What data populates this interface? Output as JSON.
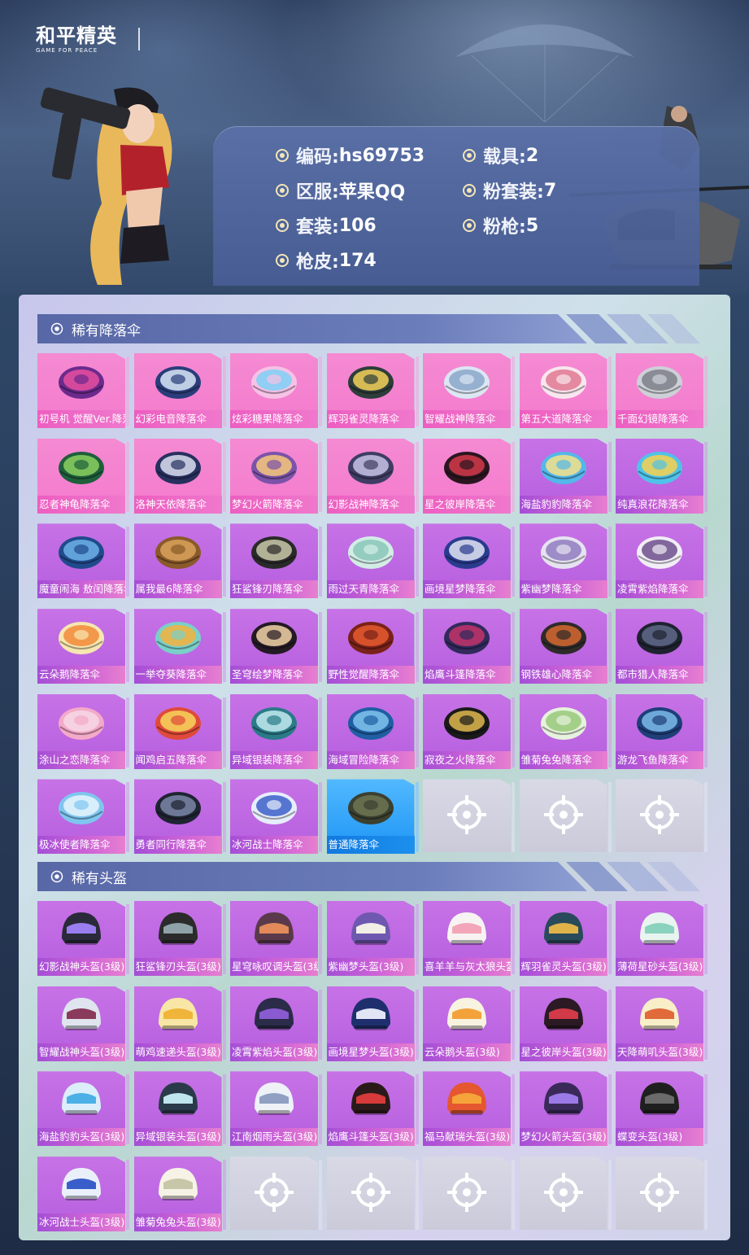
{
  "header": {
    "logo_cn": "和平精英",
    "logo_en": "GAME FOR PEACE",
    "info": [
      {
        "label": "编码: ",
        "value": "hs69753"
      },
      {
        "label": "区服: ",
        "value": "苹果QQ"
      },
      {
        "label": "套装: ",
        "value": "106"
      },
      {
        "label": "枪皮: ",
        "value": "174"
      },
      {
        "label": "载具: ",
        "value": "2"
      },
      {
        "label": "粉套装: ",
        "value": "7"
      },
      {
        "label": "粉枪: ",
        "value": "5"
      }
    ]
  },
  "sections": [
    {
      "title": "稀有降落伞",
      "items": [
        {
          "name": "初号机 觉醒Ver.降落伞",
          "tier": "pink",
          "colors": [
            "#6b2a8c",
            "#e84fa0"
          ]
        },
        {
          "name": "幻彩电音降落伞",
          "tier": "pink",
          "colors": [
            "#2a3d7a",
            "#d9e8f8"
          ]
        },
        {
          "name": "炫彩糖果降落伞",
          "tier": "pink",
          "colors": [
            "#f6c2e6",
            "#7ed0f4"
          ]
        },
        {
          "name": "辉羽雀灵降落伞",
          "tier": "pink",
          "colors": [
            "#2d3d3a",
            "#f4d15a"
          ]
        },
        {
          "name": "智耀战神降落伞",
          "tier": "pink",
          "colors": [
            "#dce6f3",
            "#8aa6c9"
          ]
        },
        {
          "name": "第五大道降落伞",
          "tier": "pink",
          "colors": [
            "#f8e6ee",
            "#e07891"
          ]
        },
        {
          "name": "千面幻镜降落伞",
          "tier": "pink",
          "colors": [
            "#cdd0d6",
            "#7d8088"
          ]
        },
        {
          "name": "忍者神龟降落伞",
          "tier": "pink",
          "colors": [
            "#1f5f3c",
            "#8bd05e"
          ]
        },
        {
          "name": "洛神天依降落伞",
          "tier": "pink",
          "colors": [
            "#27305e",
            "#dcdff0"
          ]
        },
        {
          "name": "梦幻火箭降落伞",
          "tier": "pink",
          "colors": [
            "#7b53a9",
            "#f7c87a"
          ]
        },
        {
          "name": "幻影战神降落伞",
          "tier": "pink",
          "colors": [
            "#3f3d63",
            "#c7c3e6"
          ]
        },
        {
          "name": "星之彼岸降落伞",
          "tier": "pink",
          "colors": [
            "#2b1620",
            "#d43a4b"
          ]
        },
        {
          "name": "海盐豹豹降落伞",
          "tier": "purple",
          "colors": [
            "#53b8ea",
            "#f6e08a"
          ]
        },
        {
          "name": "纯真浪花降落伞",
          "tier": "purple",
          "colors": [
            "#4fc3e8",
            "#f6d04f"
          ]
        },
        {
          "name": "魔童闹海 敖闰降落伞",
          "tier": "purple",
          "colors": [
            "#204a8c",
            "#6db2e8"
          ]
        },
        {
          "name": "属我最6降落伞",
          "tier": "purple",
          "colors": [
            "#8a5a2a",
            "#d9a25a"
          ]
        },
        {
          "name": "狂鲨锋刃降落伞",
          "tier": "purple",
          "colors": [
            "#2a2a2a",
            "#c9c9a8"
          ]
        },
        {
          "name": "雨过天青降落伞",
          "tier": "purple",
          "colors": [
            "#d3ece6",
            "#8ac7b9"
          ]
        },
        {
          "name": "画境星梦降落伞",
          "tier": "purple",
          "colors": [
            "#2a3b8e",
            "#e3e6f5"
          ]
        },
        {
          "name": "紫幽梦降落伞",
          "tier": "purple",
          "colors": [
            "#e6e3f0",
            "#8f7cc0"
          ]
        },
        {
          "name": "凌霄紫焰降落伞",
          "tier": "purple",
          "colors": [
            "#f1eef6",
            "#6d4f8c"
          ]
        },
        {
          "name": "云朵鹅降落伞",
          "tier": "purple",
          "colors": [
            "#f6e7b0",
            "#f28a3a"
          ]
        },
        {
          "name": "一举夺葵降落伞",
          "tier": "purple",
          "colors": [
            "#7ad0c8",
            "#f4b23e"
          ]
        },
        {
          "name": "圣穹绘梦降落伞",
          "tier": "purple",
          "colors": [
            "#231a24",
            "#f2d5a8"
          ]
        },
        {
          "name": "野性觉醒降落伞",
          "tier": "purple",
          "colors": [
            "#7a2219",
            "#e65a2f"
          ]
        },
        {
          "name": "焰鹰斗篷降落伞",
          "tier": "purple",
          "colors": [
            "#312a5c",
            "#c2346a"
          ]
        },
        {
          "name": "钢铁雄心降落伞",
          "tier": "purple",
          "colors": [
            "#2e2a2a",
            "#d5692f"
          ]
        },
        {
          "name": "都市猎人降落伞",
          "tier": "purple",
          "colors": [
            "#1f2230",
            "#5f6a8a"
          ]
        },
        {
          "name": "涂山之恋降落伞",
          "tier": "purple",
          "colors": [
            "#f4a9c8",
            "#f6d8e6"
          ]
        },
        {
          "name": "闻鸡启五降落伞",
          "tier": "purple",
          "colors": [
            "#e04a3a",
            "#f6d65a"
          ]
        },
        {
          "name": "异域银装降落伞",
          "tier": "purple",
          "colors": [
            "#2a7a88",
            "#c3ebf0"
          ]
        },
        {
          "name": "海域冒险降落伞",
          "tier": "purple",
          "colors": [
            "#1f5ea3",
            "#80c4ef"
          ]
        },
        {
          "name": "寂夜之火降落伞",
          "tier": "purple",
          "colors": [
            "#1a1a1a",
            "#e1b84f"
          ]
        },
        {
          "name": "雏菊兔兔降落伞",
          "tier": "purple",
          "colors": [
            "#e6f2dd",
            "#98c97a"
          ]
        },
        {
          "name": "游龙飞鱼降落伞",
          "tier": "purple",
          "colors": [
            "#1e3f79",
            "#7bbbe9"
          ]
        },
        {
          "name": "极冰使者降落伞",
          "tier": "purple",
          "colors": [
            "#7fc6ef",
            "#e8f5fd"
          ]
        },
        {
          "name": "勇者同行降落伞",
          "tier": "purple",
          "colors": [
            "#1f2432",
            "#7b86a8"
          ]
        },
        {
          "name": "冰河战士降落伞",
          "tier": "purple",
          "colors": [
            "#e7eefb",
            "#3b5fc9"
          ]
        },
        {
          "name": "普通降落伞",
          "tier": "blue",
          "colors": [
            "#3b4030",
            "#6f7552"
          ]
        },
        {
          "name": "",
          "tier": "empty"
        },
        {
          "name": "",
          "tier": "empty"
        },
        {
          "name": "",
          "tier": "empty"
        }
      ]
    },
    {
      "title": "稀有头盔",
      "items": [
        {
          "name": "幻影战神头盔(3级)",
          "tier": "purple",
          "colors": [
            "#2a2a3a",
            "#9a7ef0"
          ]
        },
        {
          "name": "狂鲨锋刃头盔(3级)",
          "tier": "purple",
          "colors": [
            "#2b2b2b",
            "#8fa2a8"
          ]
        },
        {
          "name": "星穹咏叹调头盔(3级)",
          "tier": "purple",
          "colors": [
            "#5a3a4a",
            "#e28a5a"
          ]
        },
        {
          "name": "紫幽梦头盔(3级)",
          "tier": "purple",
          "colors": [
            "#6f58b0",
            "#f2efe6"
          ]
        },
        {
          "name": "喜羊羊与灰太狼头盔(3级)",
          "tier": "purple",
          "colors": [
            "#f7f3f3",
            "#f2a6b8"
          ]
        },
        {
          "name": "辉羽雀灵头盔(3级)",
          "tier": "purple",
          "colors": [
            "#284a5a",
            "#e0b24a"
          ]
        },
        {
          "name": "薄荷星砂头盔(3级)",
          "tier": "purple",
          "colors": [
            "#e8f4f0",
            "#8ad2bd"
          ]
        },
        {
          "name": "智耀战神头盔(3级)",
          "tier": "purple",
          "colors": [
            "#dfe4ee",
            "#8a3a5a"
          ]
        },
        {
          "name": "萌鸡速递头盔(3级)",
          "tier": "purple",
          "colors": [
            "#f8e6a6",
            "#f0b43a"
          ]
        },
        {
          "name": "凌霄紫焰头盔(3级)",
          "tier": "purple",
          "colors": [
            "#2b2b4a",
            "#8a5ad0"
          ]
        },
        {
          "name": "画境星梦头盔(3级)",
          "tier": "purple",
          "colors": [
            "#1f2f6e",
            "#e2e6f4"
          ]
        },
        {
          "name": "云朵鹅头盔(3级)",
          "tier": "purple",
          "colors": [
            "#f8f2e0",
            "#f3a23a"
          ]
        },
        {
          "name": "星之彼岸头盔(3级)",
          "tier": "purple",
          "colors": [
            "#2b1a24",
            "#d23a48"
          ]
        },
        {
          "name": "天降萌叽头盔(3级)",
          "tier": "purple",
          "colors": [
            "#f8eec8",
            "#e06a3a"
          ]
        },
        {
          "name": "海盐豹豹头盔(3级)",
          "tier": "purple",
          "colors": [
            "#dbeefa",
            "#4cb0e6"
          ]
        },
        {
          "name": "异域银装头盔(3级)",
          "tier": "purple",
          "colors": [
            "#2a3a4a",
            "#bfe5ee"
          ]
        },
        {
          "name": "江南烟雨头盔(3级)",
          "tier": "purple",
          "colors": [
            "#eef1f6",
            "#8fa0c3"
          ]
        },
        {
          "name": "焰鹰斗篷头盔(3级)",
          "tier": "purple",
          "colors": [
            "#2b1a1a",
            "#d63a3a"
          ]
        },
        {
          "name": "福马献瑞头盔(3级)",
          "tier": "purple",
          "colors": [
            "#e5572f",
            "#f6a43a"
          ]
        },
        {
          "name": "梦幻火箭头盔(3级)",
          "tier": "purple",
          "colors": [
            "#3a2a5a",
            "#9b7ae8"
          ]
        },
        {
          "name": "蝶变头盔(3级)",
          "tier": "purple",
          "colors": [
            "#1f1f1f",
            "#6a6a6a"
          ]
        },
        {
          "name": "冰河战士头盔(3级)",
          "tier": "purple",
          "colors": [
            "#eaf0fa",
            "#3a5ec9"
          ]
        },
        {
          "name": "雏菊兔兔头盔(3级)",
          "tier": "purple",
          "colors": [
            "#f6f3e6",
            "#c8c6a8"
          ]
        },
        {
          "name": "",
          "tier": "empty"
        },
        {
          "name": "",
          "tier": "empty"
        },
        {
          "name": "",
          "tier": "empty"
        },
        {
          "name": "",
          "tier": "empty"
        },
        {
          "name": "",
          "tier": "empty"
        }
      ]
    }
  ]
}
